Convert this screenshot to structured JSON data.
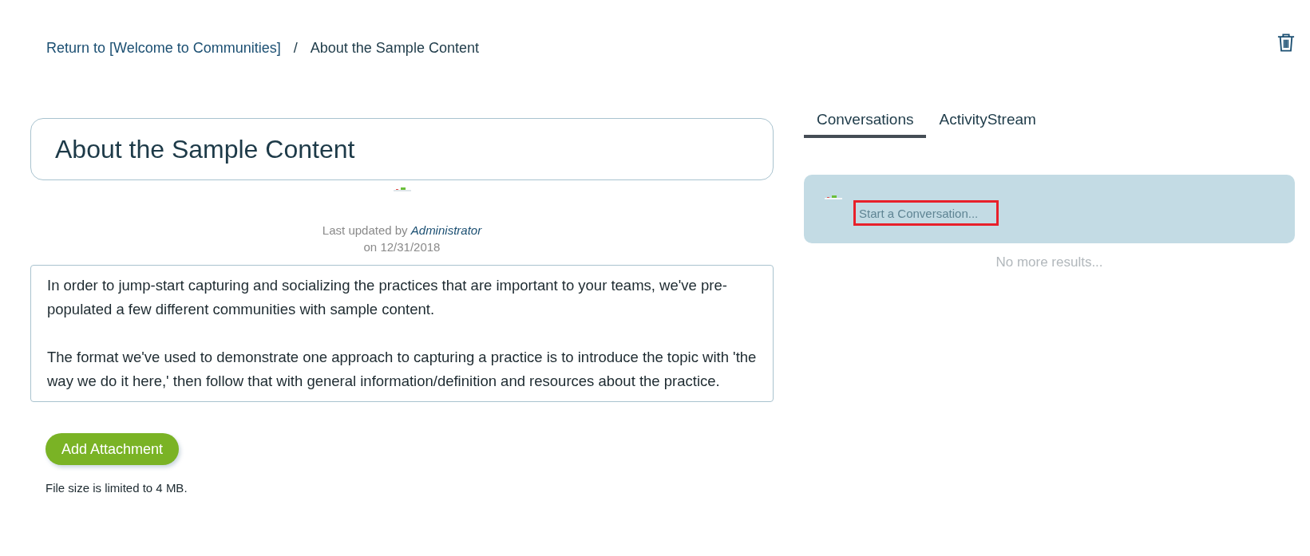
{
  "breadcrumb": {
    "link": "Return to [Welcome to Communities]",
    "separator": "/",
    "current": "About the Sample Content"
  },
  "title": "About the Sample Content",
  "updated": {
    "prefix": "Last updated by",
    "author": "Administrator",
    "date": "on 12/31/2018"
  },
  "paragraphs": [
    "In order to jump-start capturing and socializing the practices that are important to your teams, we've pre-populated a few different communities with sample content.",
    "The format we've used to demonstrate one approach to capturing a practice is to introduce the topic with 'the way we do it here,' then follow that with general information/definition and resources about the practice."
  ],
  "attachment": {
    "button": "Add Attachment",
    "note": "File size is limited to 4 MB."
  },
  "tabs": [
    {
      "label": "Conversations",
      "selected": true
    },
    {
      "label": "ActivityStream",
      "selected": false
    }
  ],
  "conversation": {
    "placeholder": "Start a Conversation...",
    "highlighted": true
  },
  "no_more": "No more results..."
}
